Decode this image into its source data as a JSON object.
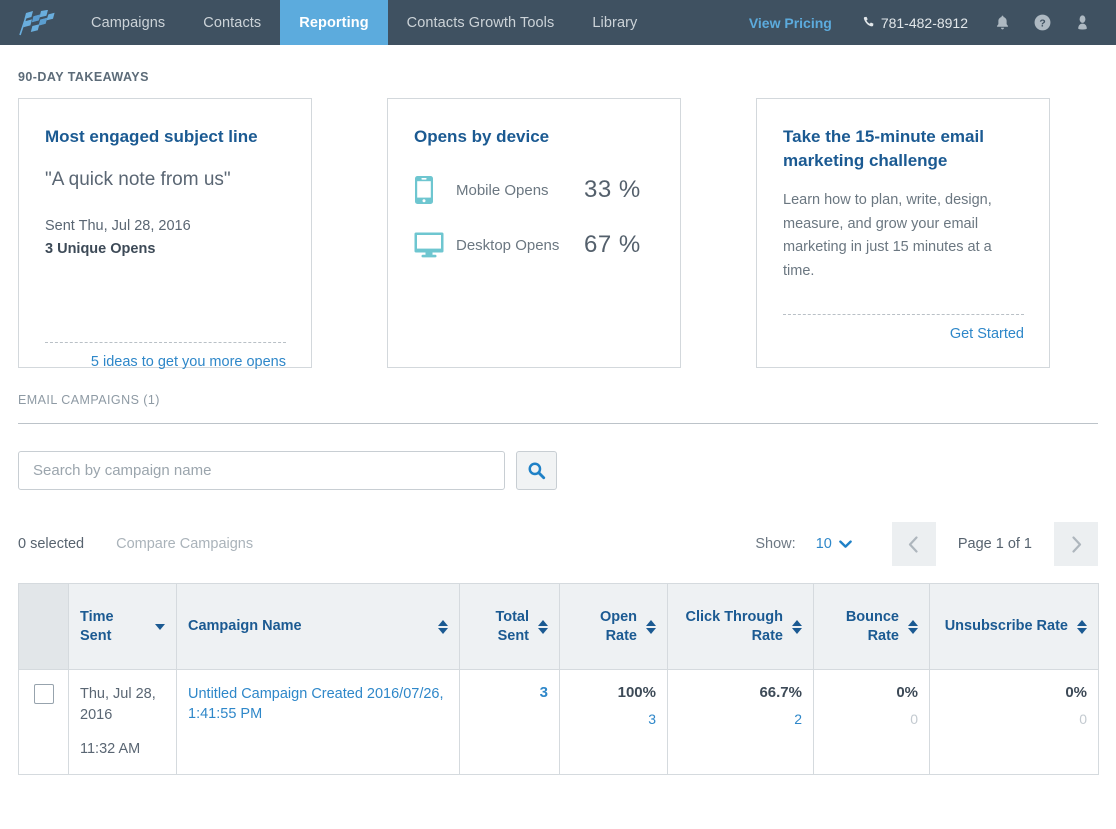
{
  "nav": {
    "logo_icon": "checkered-flag-logo",
    "items": [
      {
        "label": "Campaigns",
        "active": false
      },
      {
        "label": "Contacts",
        "active": false
      },
      {
        "label": "Reporting",
        "active": true
      },
      {
        "label": "Contacts Growth Tools",
        "active": false
      },
      {
        "label": "Library",
        "active": false
      }
    ],
    "view_pricing": "View Pricing",
    "phone": "781-482-8912",
    "icons": [
      "bell-icon",
      "help-icon",
      "user-icon"
    ]
  },
  "takeaways": {
    "heading": "90-DAY TAKEAWAYS",
    "subject_card": {
      "title": "Most engaged subject line",
      "subject": "\"A quick note from us\"",
      "sent": "Sent Thu, Jul 28, 2016",
      "opens": "3 Unique Opens",
      "link": "5 ideas to get you more opens"
    },
    "device_card": {
      "title": "Opens by device",
      "rows": [
        {
          "icon": "mobile-phone-icon",
          "label": "Mobile Opens",
          "value": "33 %"
        },
        {
          "icon": "desktop-monitor-icon",
          "label": "Desktop Opens",
          "value": "67 %"
        }
      ]
    },
    "challenge_card": {
      "title": "Take the 15-minute email marketing challenge",
      "body": "Learn how to plan, write, design, measure, and grow your email marketing in just 15 minutes at a time.",
      "link": "Get Started"
    }
  },
  "campaigns": {
    "heading": "EMAIL CAMPAIGNS (1)",
    "search_placeholder": "Search by campaign name",
    "search_value": "",
    "search_icon": "search-icon",
    "selected_count": "0 selected",
    "compare_label": "Compare Campaigns",
    "show_label": "Show:",
    "show_value": "10",
    "page_text": "Page 1 of 1",
    "columns": [
      {
        "label": "Time Sent",
        "align": "left",
        "sort": "desc"
      },
      {
        "label": "Campaign Name",
        "align": "left",
        "sort": "both"
      },
      {
        "label": "Total Sent",
        "align": "right",
        "sort": "both"
      },
      {
        "label": "Open Rate",
        "align": "right",
        "sort": "both"
      },
      {
        "label": "Click Through Rate",
        "align": "right",
        "sort": "both"
      },
      {
        "label": "Bounce Rate",
        "align": "right",
        "sort": "both"
      },
      {
        "label": "Unsubscribe Rate",
        "align": "right",
        "sort": "both"
      }
    ],
    "rows": [
      {
        "checked": false,
        "date": "Thu, Jul 28, 2016",
        "time": "11:32 AM",
        "name": "Untitled Campaign Created 2016/07/26, 1:41:55 PM",
        "total_sent": "3",
        "open_rate": "100%",
        "open_count": "3",
        "ctr": "66.7%",
        "click_count": "2",
        "bounce_rate": "0%",
        "bounce_count": "0",
        "unsub_rate": "0%",
        "unsub_count": "0"
      }
    ]
  },
  "colors": {
    "nav_bg": "#3f5161",
    "accent_blue": "#5cabdd",
    "link_blue": "#2e87c9",
    "heading_blue": "#1b5a92",
    "teal": "#6ec6d0"
  }
}
